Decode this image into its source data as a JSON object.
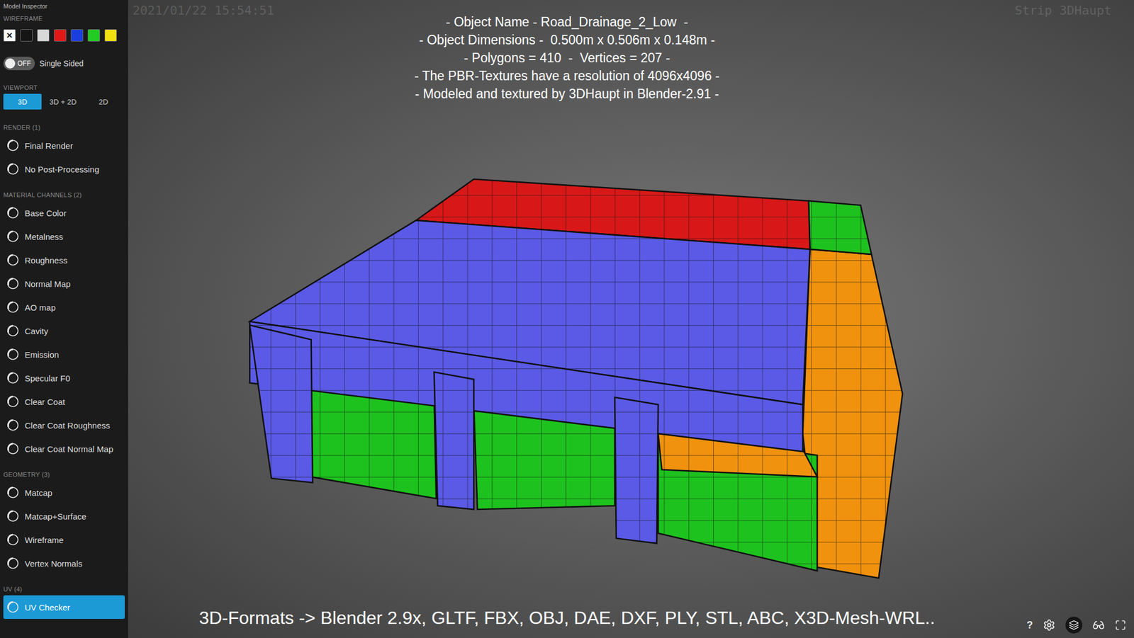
{
  "sidebar": {
    "title": "Model Inspector",
    "wireframe": {
      "label": "WIREFRAME",
      "selected_mark": "✕",
      "swatches": [
        {
          "color": "#ffffff",
          "selected": true
        },
        {
          "color": "#151515",
          "selected": false
        },
        {
          "color": "#d8d8d8",
          "selected": false
        },
        {
          "color": "#e01818",
          "selected": false
        },
        {
          "color": "#1a3ee0",
          "selected": false
        },
        {
          "color": "#22cc22",
          "selected": false
        },
        {
          "color": "#f0e010",
          "selected": false
        }
      ]
    },
    "single_sided": {
      "toggle": "OFF",
      "on": false,
      "label": "Single Sided"
    },
    "viewport": {
      "label": "VIEWPORT",
      "tabs": [
        {
          "label": "3D",
          "selected": true
        },
        {
          "label": "3D + 2D",
          "selected": false
        },
        {
          "label": "2D",
          "selected": false
        }
      ]
    },
    "sections": [
      {
        "label": "RENDER (1)",
        "items": [
          {
            "label": "Final Render",
            "selected": false
          },
          {
            "label": "No Post-Processing",
            "selected": false
          }
        ]
      },
      {
        "label": "MATERIAL CHANNELS (2)",
        "items": [
          {
            "label": "Base Color",
            "selected": false
          },
          {
            "label": "Metalness",
            "selected": false
          },
          {
            "label": "Roughness",
            "selected": false
          },
          {
            "label": "Normal Map",
            "selected": false
          },
          {
            "label": "AO map",
            "selected": false
          },
          {
            "label": "Cavity",
            "selected": false
          },
          {
            "label": "Emission",
            "selected": false
          },
          {
            "label": "Specular F0",
            "selected": false
          },
          {
            "label": "Clear Coat",
            "selected": false
          },
          {
            "label": "Clear Coat Roughness",
            "selected": false
          },
          {
            "label": "Clear Coat Normal Map",
            "selected": false
          }
        ]
      },
      {
        "label": "GEOMETRY (3)",
        "items": [
          {
            "label": "Matcap",
            "selected": false
          },
          {
            "label": "Matcap+Surface",
            "selected": false
          },
          {
            "label": "Wireframe",
            "selected": false
          },
          {
            "label": "Vertex Normals",
            "selected": false
          }
        ]
      },
      {
        "label": "UV (4)",
        "items": [
          {
            "label": "UV Checker",
            "selected": true
          }
        ]
      }
    ]
  },
  "overlay": {
    "timestamp": "2021/01/22 15:54:51",
    "strip": "Strip 3DHaupt"
  },
  "info": [
    "- Object Name - Road_Drainage_2_Low  -",
    "- Object Dimensions -  0.500m x 0.506m x 0.148m -",
    "- Polygons = 410  -  Vertices = 207 -",
    "- The PBR-Textures have a resolution of 4096x4096 -",
    "- Modeled and textured by 3DHaupt in Blender-2.91 -"
  ],
  "formats": "3D-Formats -> Blender 2.9x, GLTF, FBX, OBJ, DAE, DXF, PLY, STL, ABC, X3D-Mesh-WRL..",
  "controls": {
    "help": "?"
  }
}
